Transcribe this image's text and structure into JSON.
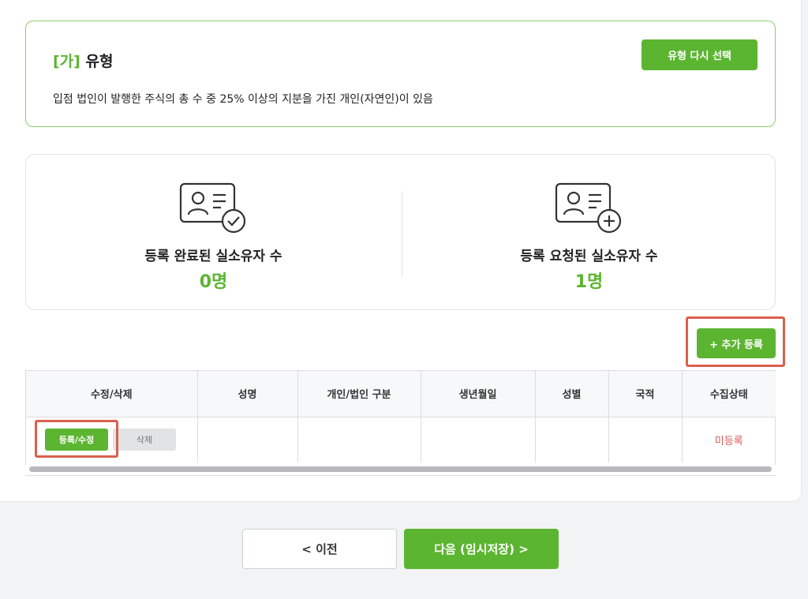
{
  "type_card": {
    "tag": "[가]",
    "title": "유형",
    "reselect_label": "유형 다시 선택",
    "description": "입점 법인이 발행한 주식의 총 수 중 25% 이상의 지분을 가진 개인(자연인)이 있음"
  },
  "stats": {
    "registered": {
      "label": "등록 완료된 실소유자 수",
      "value": "0명",
      "icon": "id-card-check-icon"
    },
    "requested": {
      "label": "등록 요청된 실소유자 수",
      "value": "1명",
      "icon": "id-card-plus-icon"
    }
  },
  "add_button": {
    "label": "+ 추가 등록"
  },
  "table": {
    "headers": [
      "수정/삭제",
      "성명",
      "개인/법인 구분",
      "생년월일",
      "성별",
      "국적",
      "수집상태"
    ],
    "rows": [
      {
        "edit_label": "등록/수정",
        "delete_label": "삭제",
        "name": "",
        "kind": "",
        "birth": "",
        "gender": "",
        "nationality": "",
        "status": "미등록"
      }
    ]
  },
  "nav": {
    "prev_label": "< 이전",
    "next_label": "다음 (임시저장) >"
  },
  "colors": {
    "accent": "#5cb531",
    "highlight": "#d9604c",
    "status_unregistered": "#d65a5a"
  }
}
